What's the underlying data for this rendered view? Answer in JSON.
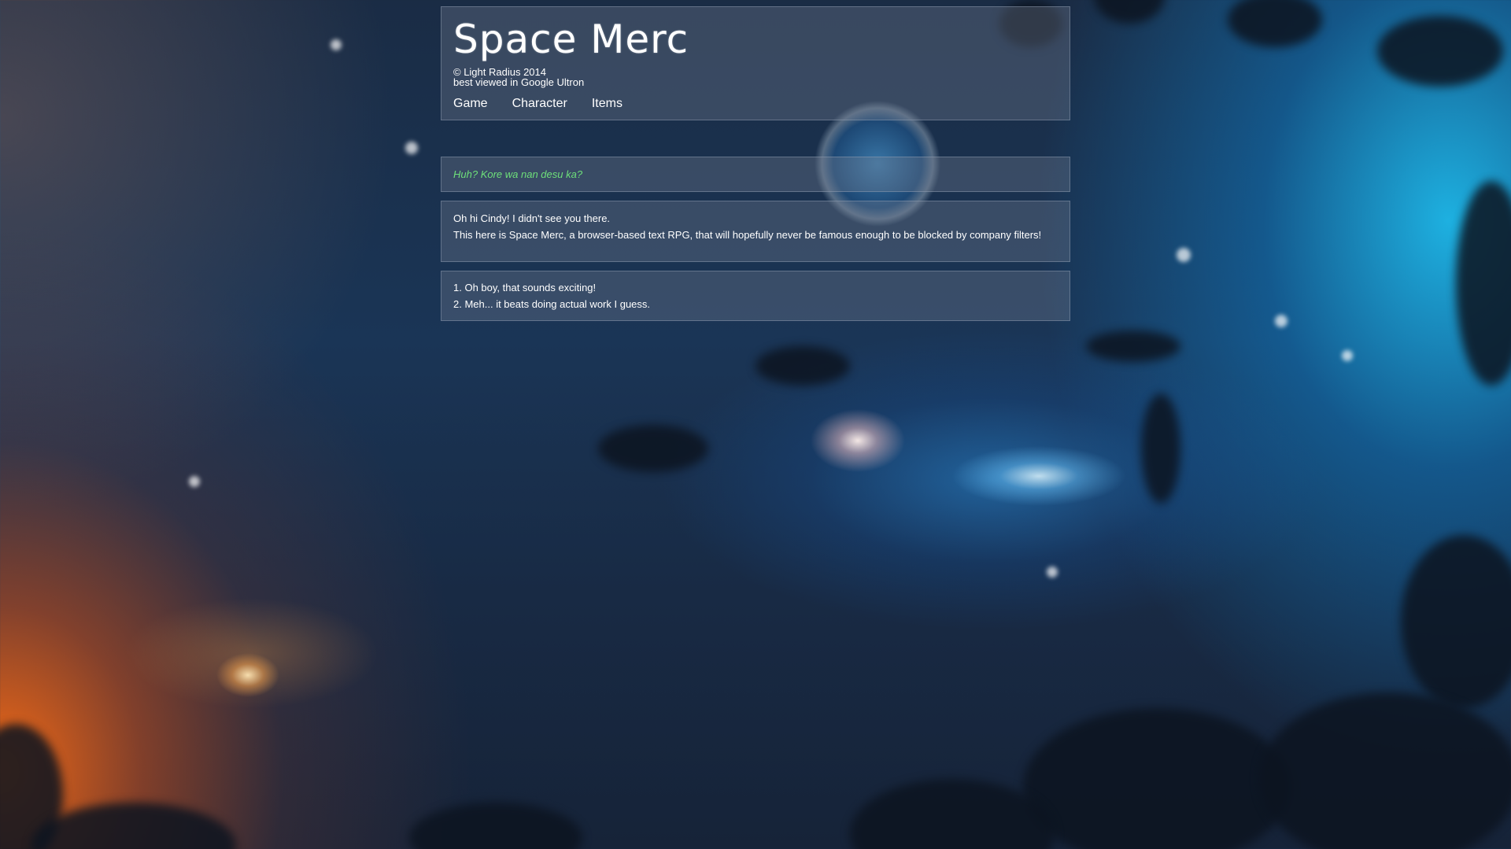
{
  "header": {
    "title": "Space Merc",
    "copyright": "© Light Radius 2014",
    "tagline": "best viewed in Google Ultron",
    "nav": [
      {
        "label": "Game"
      },
      {
        "label": "Character"
      },
      {
        "label": "Items"
      }
    ]
  },
  "dialogue": {
    "quote": "Huh? Kore wa nan desu ka?",
    "story": [
      "Oh hi Cindy! I didn't see you there.",
      "This here is Space Merc, a browser-based text RPG, that will hopefully never be famous enough to be blocked by company filters!"
    ],
    "choices": [
      "1. Oh boy, that sounds exciting!",
      "2. Meh... it beats doing actual work I guess."
    ]
  },
  "colors": {
    "quote_text": "#6ee07a",
    "panel_background": "rgba(120,130,150,0.33)",
    "text": "#ffffff"
  }
}
